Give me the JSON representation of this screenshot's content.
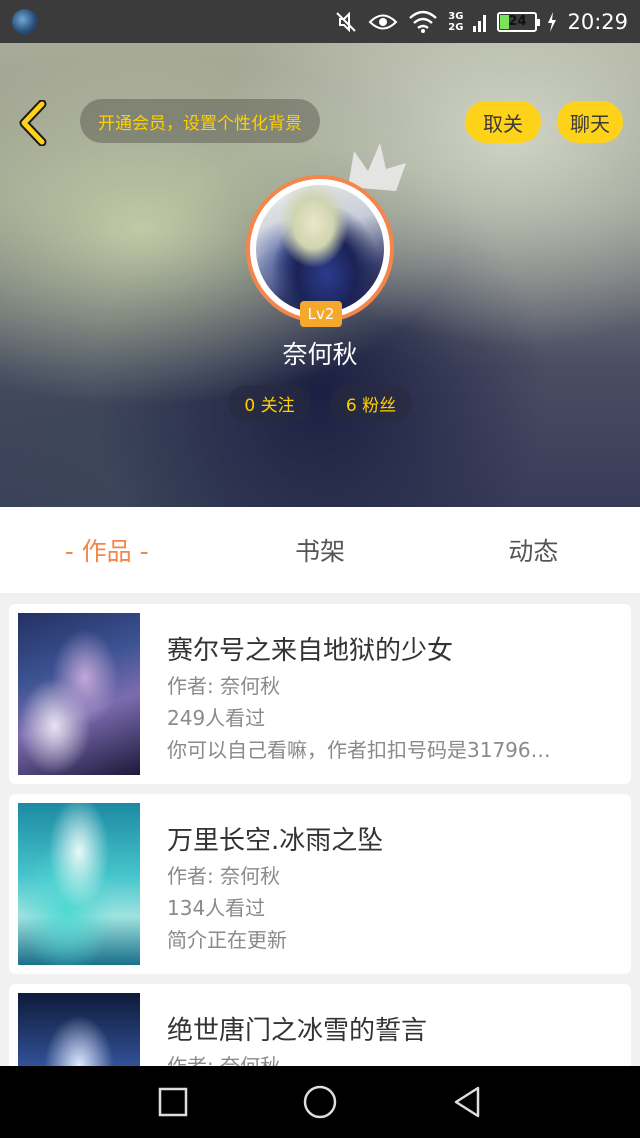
{
  "status_bar": {
    "icons": [
      "mute-icon",
      "eye-icon",
      "wifi-icon",
      "signal-icon",
      "charging-icon"
    ],
    "network": [
      "3G",
      "2G"
    ],
    "battery": "24",
    "time": "20:29"
  },
  "header": {
    "vip_banner": "开通会员，设置个性化背景",
    "unfollow_label": "取关",
    "chat_label": "聊天",
    "level": "Lv2",
    "username": "奈何秋",
    "following": "0 关注",
    "fans": "6 粉丝"
  },
  "tabs": [
    {
      "label": "- 作品 -",
      "active": true
    },
    {
      "label": "书架",
      "active": false
    },
    {
      "label": "动态",
      "active": false
    }
  ],
  "books": [
    {
      "title": "赛尔号之来自地狱的少女",
      "author": "作者: 奈何秋",
      "views": "249人看过",
      "intro": "你可以自己看嘛，作者扣扣号码是31796…"
    },
    {
      "title": "万里长空.冰雨之坠",
      "author": "作者: 奈何秋",
      "views": "134人看过",
      "intro": "简介正在更新"
    },
    {
      "title": "绝世唐门之冰雪的誓言",
      "author": "作者: 奈何秋",
      "views": "",
      "intro": ""
    }
  ],
  "colors": {
    "accent": "#f4854b",
    "yellow": "#ffd21a",
    "vip_text": "#ffd000"
  }
}
